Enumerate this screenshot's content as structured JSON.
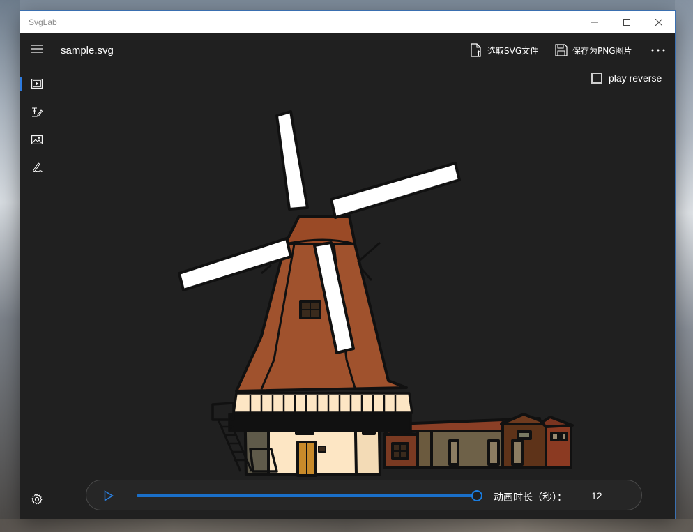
{
  "window": {
    "title": "SvgLab"
  },
  "document": {
    "file_name": "sample.svg"
  },
  "commands": {
    "open_svg": "选取SVG文件",
    "save_png": "保存为PNG图片"
  },
  "options": {
    "play_reverse_label": "play reverse",
    "play_reverse_checked": false
  },
  "player": {
    "progress": 1.0,
    "duration_label": "动画时长（秒）：",
    "duration_value": "12"
  },
  "nav": {
    "items": [
      {
        "icon": "animation-player-icon",
        "selected": true
      },
      {
        "icon": "text-pen-icon",
        "selected": false
      },
      {
        "icon": "image-icon",
        "selected": false
      },
      {
        "icon": "signature-pen-icon",
        "selected": false
      }
    ],
    "footer_icon": "settings-gear-icon"
  },
  "colors": {
    "accent": "#1a6fc9",
    "window_bg": "#202020",
    "roof": "#a0522d",
    "wall": "#fde6c4"
  }
}
